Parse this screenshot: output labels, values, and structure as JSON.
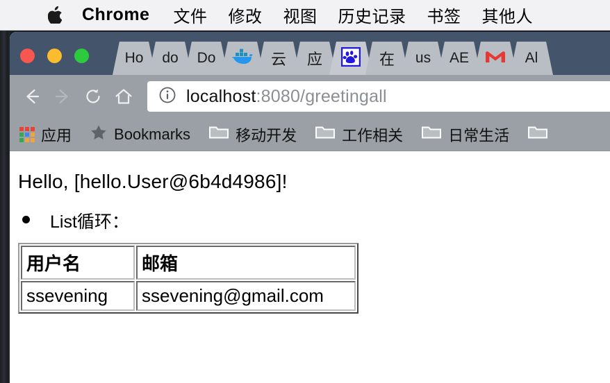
{
  "menubar": {
    "apple_icon": "apple-logo-icon",
    "items": [
      {
        "label": "Chrome",
        "bold": true
      },
      {
        "label": "文件",
        "bold": false
      },
      {
        "label": "修改",
        "bold": false
      },
      {
        "label": "视图",
        "bold": false
      },
      {
        "label": "历史记录",
        "bold": false
      },
      {
        "label": "书签",
        "bold": false
      },
      {
        "label": "其他人",
        "bold": false
      }
    ]
  },
  "window": {
    "traffic_lights": {
      "close_color": "#f9564f",
      "minimize_color": "#fbbc2e",
      "maximize_color": "#2ccb3f"
    },
    "tabstrip_color": "#44546b",
    "toolbar_color": "#9aa0a6"
  },
  "tabs": [
    {
      "label": "Ho",
      "icon": "",
      "active": false
    },
    {
      "label": "do",
      "icon": "",
      "active": false
    },
    {
      "label": "Do",
      "icon": "",
      "active": false
    },
    {
      "label": "",
      "icon": "docker-whale-icon",
      "active": false
    },
    {
      "label": "云",
      "icon": "",
      "active": false
    },
    {
      "label": "应",
      "icon": "",
      "active": false
    },
    {
      "label": "",
      "icon": "baidu-paw-icon",
      "active": true
    },
    {
      "label": "在",
      "icon": "",
      "active": false
    },
    {
      "label": "us",
      "icon": "",
      "active": false
    },
    {
      "label": "AE",
      "icon": "",
      "active": false
    },
    {
      "label": "",
      "icon": "gmail-m-icon",
      "active": false
    },
    {
      "label": "Al",
      "icon": "",
      "active": false
    }
  ],
  "toolbar": {
    "back_icon": "back-arrow-icon",
    "forward_icon": "forward-arrow-icon",
    "reload_icon": "reload-icon",
    "home_icon": "home-icon",
    "security_icon": "info-circle-icon",
    "url_host": "localhost",
    "url_rest": ":8080/greetingall",
    "url_full": "localhost:8080/greetingall"
  },
  "bookmarks": [
    {
      "label": "应用",
      "icon": "apps-grid-icon"
    },
    {
      "label": "Bookmarks",
      "icon": "star-icon"
    },
    {
      "label": "移动开发",
      "icon": "folder-icon"
    },
    {
      "label": "工作相关",
      "icon": "folder-icon"
    },
    {
      "label": "日常生活",
      "icon": "folder-icon"
    },
    {
      "label": "",
      "icon": "folder-icon"
    }
  ],
  "page": {
    "greeting": "Hello, [hello.User@6b4d4986]!",
    "list_items": [
      "List循环："
    ],
    "table": {
      "headers": [
        "用户名",
        "邮箱"
      ],
      "rows": [
        [
          "ssevening",
          "ssevening@gmail.com"
        ]
      ]
    }
  }
}
